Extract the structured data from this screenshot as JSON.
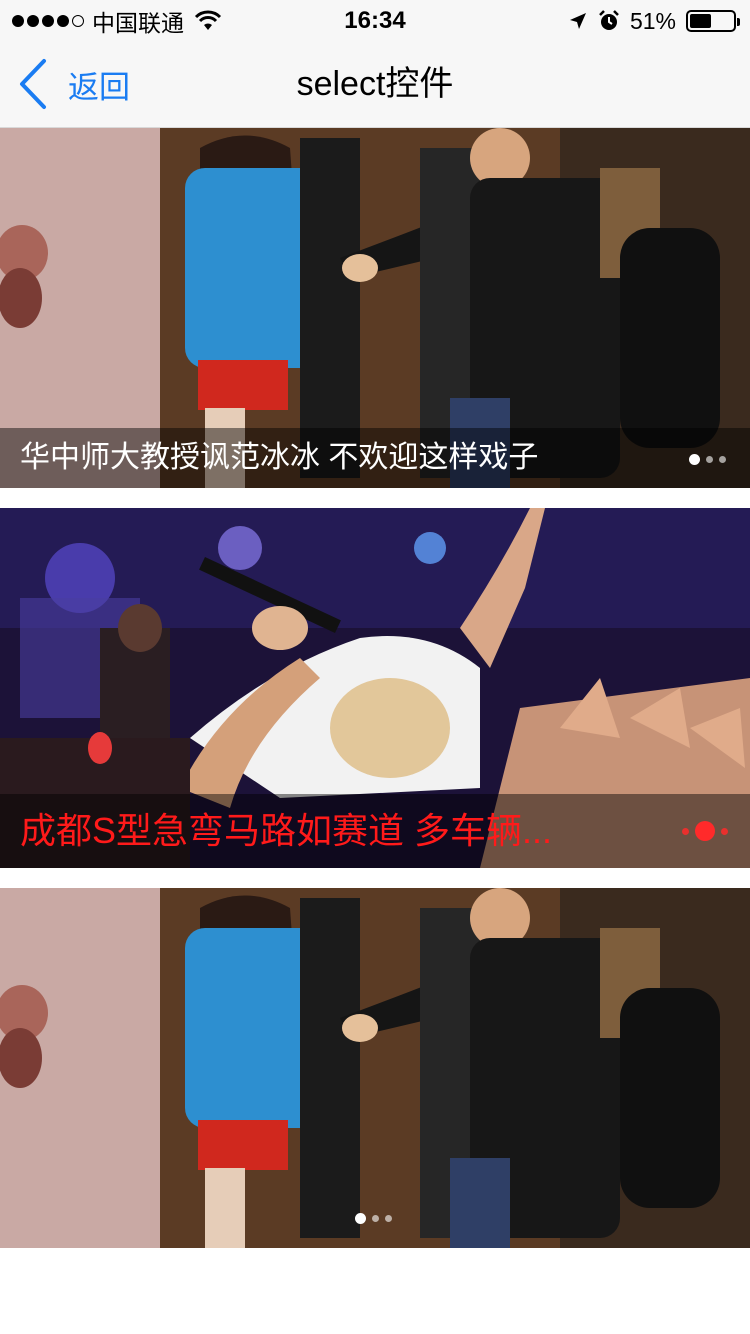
{
  "status_bar": {
    "carrier": "中国联通",
    "time": "16:34",
    "battery_percent": "51%",
    "battery_level": 0.51,
    "icons": [
      "signal-dots",
      "wifi-icon",
      "location-arrow-icon",
      "alarm-icon",
      "battery-icon"
    ]
  },
  "nav": {
    "back_label": "返回",
    "title": "select控件"
  },
  "slides": [
    {
      "caption": "华中师大教授讽范冰冰 不欢迎这样戏子",
      "pages": 3,
      "active_page": 1
    },
    {
      "caption": "成都S型急弯马路如赛道 多车辆...",
      "pages": 3,
      "active_page": 2
    },
    {
      "caption": "",
      "pages": 3,
      "active_page": 1
    }
  ],
  "colors": {
    "accent": "#1a7cf2",
    "caption_highlight": "#ff1a1a"
  }
}
